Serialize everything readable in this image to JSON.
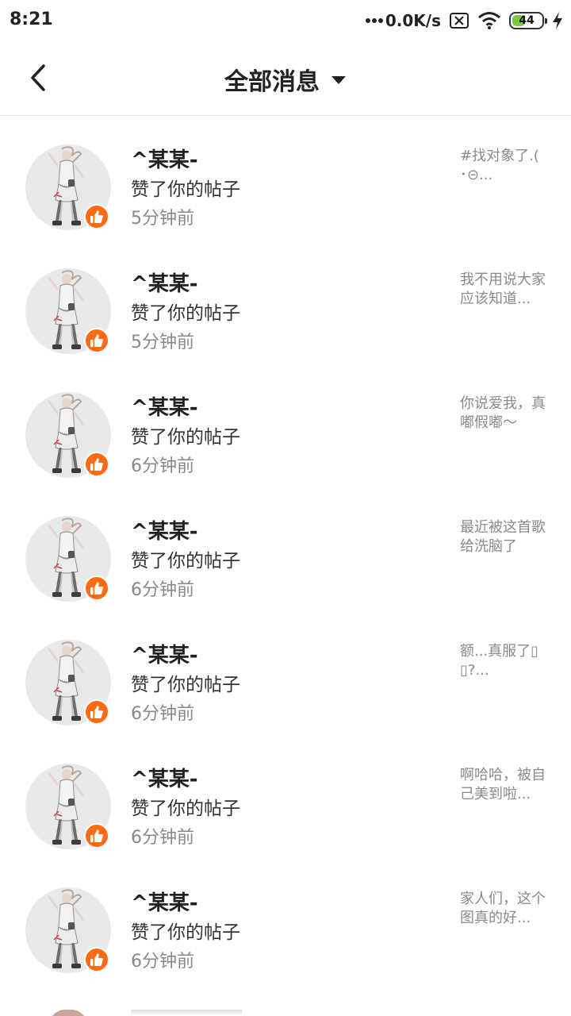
{
  "status_bar": {
    "time": "8:21",
    "net_speed": "0.0K/s",
    "battery_level": "44",
    "battery_fraction": 0.44,
    "icons": [
      "dots-icon",
      "sim-x-icon",
      "wifi-icon",
      "battery-icon",
      "charging-icon"
    ],
    "accent_battery": "#7ac943"
  },
  "header": {
    "title": "全部消息",
    "back_icon": "chevron-left-icon",
    "dropdown_icon": "caret-down-icon"
  },
  "colors": {
    "like_badge": "#ff6a13",
    "preview_text": "#8a8a8a",
    "time_text": "#888888"
  },
  "messages": [
    {
      "user": "^某某-",
      "action": "赞了你的帖子",
      "time": "5分钟前",
      "preview": "#找对象了.( ･⊝..."
    },
    {
      "user": "^某某-",
      "action": "赞了你的帖子",
      "time": "5分钟前",
      "preview": "我不用说大家应该知道..."
    },
    {
      "user": "^某某-",
      "action": "赞了你的帖子",
      "time": "6分钟前",
      "preview": "你说爱我，真嘟假嘟～"
    },
    {
      "user": "^某某-",
      "action": "赞了你的帖子",
      "time": "6分钟前",
      "preview": "最近被这首歌给洗脑了"
    },
    {
      "user": "^某某-",
      "action": "赞了你的帖子",
      "time": "6分钟前",
      "preview": "额...真服了▯▯?..."
    },
    {
      "user": "^某某-",
      "action": "赞了你的帖子",
      "time": "6分钟前",
      "preview": "啊哈哈，被自己美到啦..."
    },
    {
      "user": "^某某-",
      "action": "赞了你的帖子",
      "time": "6分钟前",
      "preview": "家人们，这个图真的好..."
    }
  ]
}
